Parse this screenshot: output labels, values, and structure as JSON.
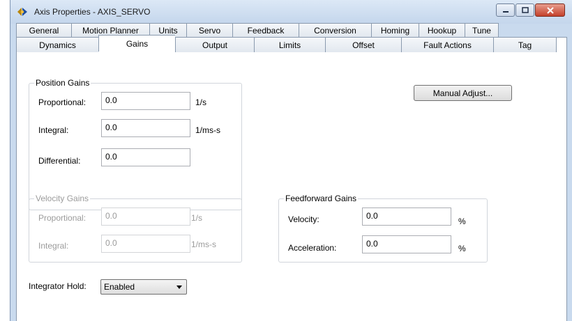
{
  "window": {
    "title": "Axis Properties - AXIS_SERVO",
    "icon": "axis-gear-icon"
  },
  "tabs": {
    "row1": [
      "General",
      "Motion Planner",
      "Units",
      "Servo",
      "Feedback",
      "Conversion",
      "Homing",
      "Hookup",
      "Tune"
    ],
    "row2": [
      "Dynamics",
      "Gains",
      "Output",
      "Limits",
      "Offset",
      "Fault Actions",
      "Tag"
    ],
    "active": "Gains"
  },
  "position_gains": {
    "title": "Position Gains",
    "proportional": {
      "label": "Proportional:",
      "value": "0.0",
      "unit": "1/s"
    },
    "integral": {
      "label": "Integral:",
      "value": "0.0",
      "unit": "1/ms-s"
    },
    "differential": {
      "label": "Differential:",
      "value": "0.0"
    }
  },
  "velocity_gains": {
    "title": "Velocity Gains",
    "proportional": {
      "label": "Proportional:",
      "value": "0.0",
      "unit": "1/s"
    },
    "integral": {
      "label": "Integral:",
      "value": "0.0",
      "unit": "1/ms-s"
    }
  },
  "feedforward_gains": {
    "title": "Feedforward Gains",
    "velocity": {
      "label": "Velocity:",
      "value": "0.0",
      "unit": "%"
    },
    "acceleration": {
      "label": "Acceleration:",
      "value": "0.0",
      "unit": "%"
    }
  },
  "manual_adjust_label": "Manual Adjust...",
  "integrator_hold": {
    "label": "Integrator Hold:",
    "value": "Enabled"
  },
  "colors": {
    "titlebar": "#c4d6ec",
    "close_button": "#c4412b",
    "disabled_text": "#9b9b9b"
  }
}
